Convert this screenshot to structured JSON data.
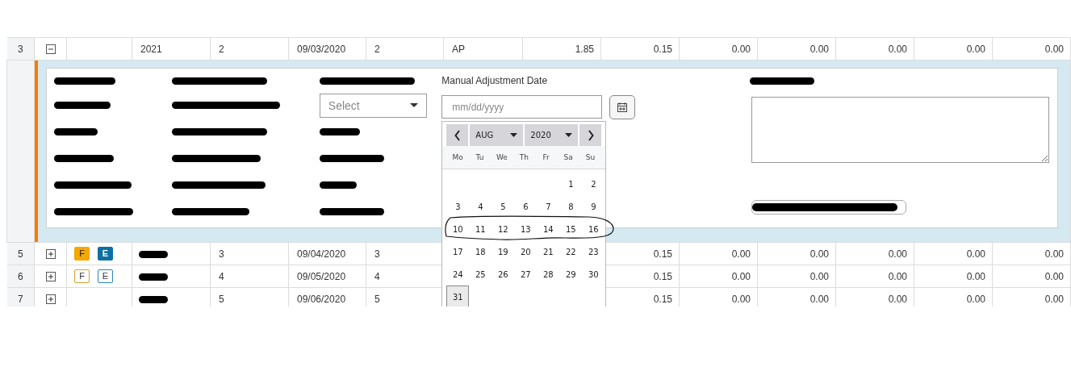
{
  "rows": [
    {
      "number": "3",
      "expanded": true,
      "cells": [
        "2021",
        "2",
        "09/03/2020",
        "2",
        "AP",
        "1.85",
        "0.15",
        "0.00",
        "0.00",
        "0.00",
        "0.00",
        "0.00"
      ]
    },
    {
      "number": "5",
      "expanded": false,
      "badges": [
        {
          "label": "F",
          "filled": true,
          "color": "#f5a800"
        },
        {
          "label": "E",
          "filled": true,
          "color": "#0e6fa3"
        }
      ],
      "cells": [
        {
          "kind": "redacted"
        },
        "3",
        "09/04/2020",
        "3",
        {
          "kind": "covered"
        },
        {
          "kind": "covered"
        },
        "0.15",
        "0.00",
        "0.00",
        "0.00",
        "0.00",
        "0.00"
      ]
    },
    {
      "number": "6",
      "expanded": false,
      "badges": [
        {
          "label": "F",
          "filled": false,
          "color": "#d9a030"
        },
        {
          "label": "E",
          "filled": false,
          "color": "#2a85c0"
        }
      ],
      "cells": [
        {
          "kind": "redacted"
        },
        "4",
        "09/05/2020",
        "4",
        {
          "kind": "covered"
        },
        {
          "kind": "covered"
        },
        "0.15",
        "0.00",
        "0.00",
        "0.00",
        "0.00",
        "0.00"
      ]
    },
    {
      "number": "7",
      "expanded": false,
      "cells": [
        {
          "kind": "redacted"
        },
        "5",
        "09/06/2020",
        "5",
        {
          "kind": "covered"
        },
        {
          "kind": "covered"
        },
        "0.15",
        "0.00",
        "0.00",
        "0.00",
        "0.00",
        "0.00"
      ]
    }
  ],
  "detail": {
    "columns": [
      {
        "items": [
          {
            "kind": "redacted"
          },
          {
            "kind": "redacted"
          },
          {
            "kind": "redacted"
          },
          {
            "kind": "redacted"
          },
          {
            "kind": "redacted"
          },
          {
            "kind": "redacted"
          }
        ]
      },
      {
        "items": [
          {
            "kind": "redacted"
          },
          {
            "kind": "redacted"
          },
          {
            "kind": "redacted"
          },
          {
            "kind": "redacted"
          },
          {
            "kind": "redacted"
          },
          {
            "kind": "redacted"
          }
        ]
      },
      {
        "items": [
          {
            "kind": "redacted"
          },
          {
            "kind": "select",
            "placeholder": "Select"
          },
          {
            "kind": "redacted"
          },
          {
            "kind": "redacted"
          },
          {
            "kind": "redacted"
          },
          {
            "kind": "redacted"
          }
        ]
      },
      {
        "items": [
          {
            "kind": "label",
            "text": "Manual Adjustment Date"
          },
          {
            "kind": "date",
            "placeholder": "mm/dd/yyyy"
          }
        ]
      },
      {
        "items": [
          {
            "kind": "redacted"
          },
          {
            "kind": "textarea"
          },
          {
            "kind": "redacted_button"
          }
        ]
      }
    ]
  },
  "calendar": {
    "month": "AUG",
    "year": "2020",
    "weekdays": [
      "Mo",
      "Tu",
      "We",
      "Th",
      "Fr",
      "Sa",
      "Su"
    ],
    "weeks": [
      {
        "circled": false,
        "days": [
          {
            "label": "1",
            "selected": false
          },
          {
            "label": "2",
            "selected": false
          }
        ]
      },
      {
        "circled": false,
        "days": [
          {
            "label": "3",
            "selected": false
          },
          {
            "label": "4",
            "selected": false
          },
          {
            "label": "5",
            "selected": false
          },
          {
            "label": "6",
            "selected": false
          },
          {
            "label": "7",
            "selected": false
          },
          {
            "label": "8",
            "selected": false
          },
          {
            "label": "9",
            "selected": false
          }
        ]
      },
      {
        "circled": true,
        "days": [
          {
            "label": "10",
            "selected": false
          },
          {
            "label": "11",
            "selected": false
          },
          {
            "label": "12",
            "selected": false
          },
          {
            "label": "13",
            "selected": false
          },
          {
            "label": "14",
            "selected": false
          },
          {
            "label": "15",
            "selected": false
          },
          {
            "label": "16",
            "selected": false
          }
        ]
      },
      {
        "circled": false,
        "days": [
          {
            "label": "17",
            "selected": false
          },
          {
            "label": "18",
            "selected": false
          },
          {
            "label": "19",
            "selected": false
          },
          {
            "label": "20",
            "selected": false
          },
          {
            "label": "21",
            "selected": false
          },
          {
            "label": "22",
            "selected": false
          },
          {
            "label": "23",
            "selected": false
          }
        ]
      },
      {
        "circled": false,
        "days": [
          {
            "label": "24",
            "selected": false
          },
          {
            "label": "25",
            "selected": false
          },
          {
            "label": "26",
            "selected": false
          },
          {
            "label": "27",
            "selected": false
          },
          {
            "label": "28",
            "selected": false
          },
          {
            "label": "29",
            "selected": false
          },
          {
            "label": "30",
            "selected": false
          }
        ]
      },
      {
        "circled": false,
        "days": [
          {
            "label": "31",
            "selected": true
          }
        ]
      }
    ]
  }
}
